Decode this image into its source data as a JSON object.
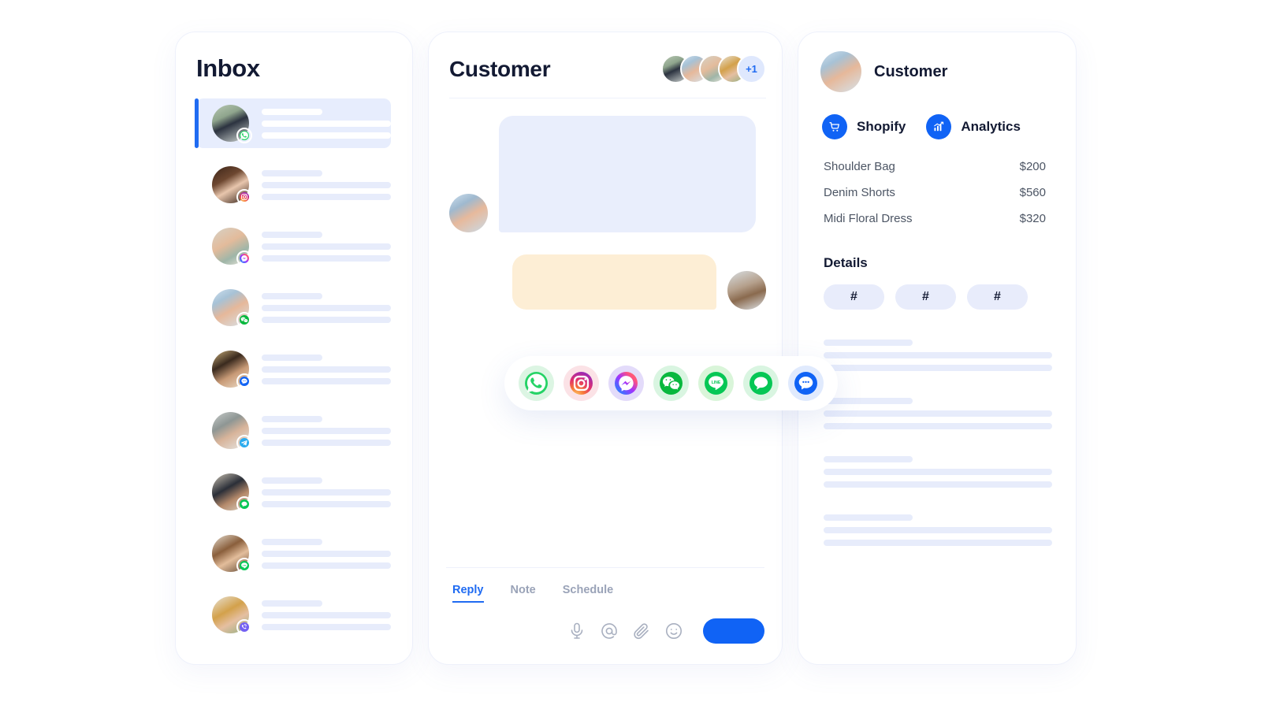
{
  "inbox": {
    "title": "Inbox",
    "items": [
      {
        "channel": "whatsapp-icon",
        "active": true
      },
      {
        "channel": "instagram-icon",
        "active": false
      },
      {
        "channel": "messenger-icon",
        "active": false
      },
      {
        "channel": "wechat-icon",
        "active": false
      },
      {
        "channel": "zalo-icon",
        "active": false
      },
      {
        "channel": "telegram-icon",
        "active": false
      },
      {
        "channel": "kakaotalk-icon",
        "active": false
      },
      {
        "channel": "line-icon",
        "active": false
      },
      {
        "channel": "viber-icon",
        "active": false
      }
    ]
  },
  "conversation": {
    "title": "Customer",
    "participants_overflow": "+1",
    "participant_count": 4,
    "messages": [
      {
        "direction": "in",
        "bubble_color": "#e9eefc"
      },
      {
        "direction": "out",
        "bubble_color": "#fdeed5"
      }
    ],
    "channels": [
      {
        "name": "whatsapp-icon",
        "label": "WhatsApp",
        "bg": "#dcf5e3"
      },
      {
        "name": "instagram-icon",
        "label": "Instagram",
        "bg": "#fbe2e6"
      },
      {
        "name": "messenger-icon",
        "label": "Messenger",
        "bg": "#e3dbfa"
      },
      {
        "name": "wechat-icon",
        "label": "WeChat",
        "bg": "#d9f5e1"
      },
      {
        "name": "line-icon",
        "label": "LINE",
        "bg": "#d9f5d9"
      },
      {
        "name": "kakaotalk-icon",
        "label": "KakaoTalk",
        "bg": "#d9f5e1"
      },
      {
        "name": "zalo-icon",
        "label": "Zalo",
        "bg": "#e0eafd"
      }
    ],
    "composer": {
      "tabs": [
        {
          "label": "Reply",
          "active": true
        },
        {
          "label": "Note",
          "active": false
        },
        {
          "label": "Schedule",
          "active": false
        }
      ],
      "tools": [
        "microphone-icon",
        "mention-icon",
        "attachment-icon",
        "emoji-icon"
      ],
      "send_label": ""
    }
  },
  "details": {
    "name": "Customer",
    "apps": [
      {
        "label": "Shopify",
        "icon": "shopping-cart-icon"
      },
      {
        "label": "Analytics",
        "icon": "bar-chart-icon"
      }
    ],
    "products": [
      {
        "name": "Shoulder Bag",
        "price": "$200"
      },
      {
        "name": "Denim Shorts",
        "price": "$560"
      },
      {
        "name": "Midi Floral Dress",
        "price": "$320"
      }
    ],
    "section_title": "Details",
    "tags": [
      "#",
      "#",
      "#"
    ],
    "skeleton_groups": 4
  },
  "colors": {
    "accent": "#1063f5",
    "accent_soft": "#e7edfd",
    "skeleton": "#e7ecfb",
    "bubble_in": "#e9eefc",
    "bubble_out": "#fdeed5",
    "text_dark": "#131a33",
    "text_muted": "#9aa3b8",
    "panel_border": "#eef1fb"
  }
}
